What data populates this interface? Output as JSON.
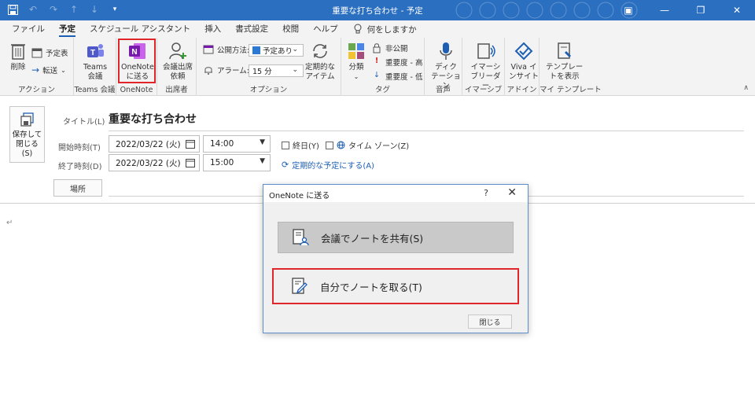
{
  "window": {
    "title": "重要な打ち合わせ - 予定",
    "minimize": "—",
    "restore": "❐",
    "close": "✕",
    "ribbon_display": "▣"
  },
  "tabs": [
    "ファイル",
    "予定",
    "スケジュール アシスタント",
    "挿入",
    "書式設定",
    "校閲",
    "ヘルプ"
  ],
  "tell_me": "何をしますか",
  "ribbon": {
    "groups": {
      "action": "アクション",
      "teams": "Teams 会議",
      "onenote": "OneNote",
      "attendees": "出席者",
      "options": "オプション",
      "tags": "タグ",
      "voice": "音声",
      "immersive": "イマーシブ",
      "addin": "アドイン",
      "template": "マイ テンプレート"
    },
    "delete": "削除",
    "calendar": "予定表",
    "forward": "転送",
    "teams_meeting": [
      "Teams",
      "会議"
    ],
    "onenote_send": [
      "OneNote",
      "に送る"
    ],
    "invite": [
      "会議出席",
      "依頼"
    ],
    "show_as_label": "公開方法:",
    "show_as_value": "予定あり",
    "reminder_label": "アラーム:",
    "reminder_value": "15 分",
    "recurrence": [
      "定期的な",
      "アイテム"
    ],
    "categorize": "分類",
    "private": "非公開",
    "high_importance": "重要度 - 高",
    "low_importance": "重要度 - 低",
    "dictate": [
      "ディク",
      "テーション"
    ],
    "immersive_reader": [
      "イマーシ",
      "ブリーダー"
    ],
    "viva": [
      "Viva イ",
      "ンサイト"
    ],
    "templates": [
      "テンプレー",
      "トを表示"
    ],
    "collapse": "∧"
  },
  "form": {
    "send": [
      "保存して",
      "閉じる",
      "(S)"
    ],
    "title_label": "タイトル(L)",
    "title_value": "重要な打ち合わせ",
    "start_label": "開始時刻(T)",
    "end_label": "終了時刻(D)",
    "start_date": "2022/03/22 (火)",
    "start_time": "14:00",
    "end_date": "2022/03/22 (火)",
    "end_time": "15:00",
    "all_day": "終日(Y)",
    "time_zone": "タイム ゾーン(Z)",
    "recurring": "定期的な予定にする(A)",
    "location_button": "場所",
    "body_cursor": "↵"
  },
  "dialog": {
    "title": "OneNote に送る",
    "help": "?",
    "close": "✕",
    "option1": "会議でノートを共有(S)",
    "option2": "自分でノートを取る(T)",
    "close_button": "閉じる"
  },
  "colors": {
    "title_bar": "#2b6fc0",
    "accent": "#1e5fb4",
    "highlight": "#e0262b",
    "onenote": "#7719aa",
    "teams": "#5059c9"
  }
}
